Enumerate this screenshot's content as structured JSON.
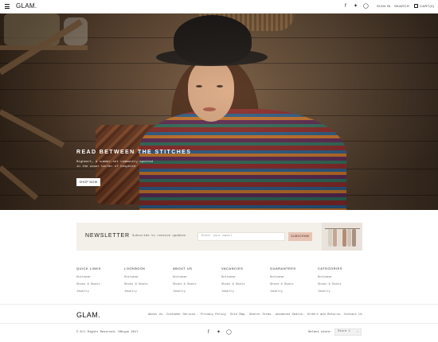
{
  "header": {
    "brand": "GLAM.",
    "social_icons": [
      "facebook-icon",
      "twitter-icon",
      "instagram-icon"
    ],
    "sign_in": "SIGN IN",
    "search": "SEARCH",
    "cart": "CART(0)"
  },
  "hero": {
    "title": "READ BETWEEN THE STITCHES",
    "subtitle": "Bigheart, a summer-set community spotted in the usual border of bosphite",
    "button": "SHOP NOW"
  },
  "newsletter": {
    "title": "NEWSLETTER",
    "description": "Subscribe to receive updates",
    "input_placeholder": "Enter your email",
    "button": "SUBSCRIBE"
  },
  "footer_columns": [
    {
      "title": "QUICK LINKS",
      "links": [
        "Knitwear",
        "Shoes & Boots",
        "Jewelry"
      ]
    },
    {
      "title": "LOOKBOOK",
      "links": [
        "Knitwear",
        "Shoes & Boots",
        "Jewelry"
      ]
    },
    {
      "title": "ABOUT US",
      "links": [
        "Knitwear",
        "Shoes & Boots",
        "Jewelry"
      ]
    },
    {
      "title": "VACANCIES",
      "links": [
        "Knitwear",
        "Shoes & Boots",
        "Jewelry"
      ]
    },
    {
      "title": "GUARANTEES",
      "links": [
        "Knitwear",
        "Shoes & Boots",
        "Jewelry"
      ]
    },
    {
      "title": "CATEGORIES",
      "links": [
        "Knitwear",
        "Shoes & Boots",
        "Jewelry"
      ]
    }
  ],
  "footer": {
    "brand": "GLAM.",
    "links": [
      "About Us",
      "Customer Service",
      "Privacy Policy",
      "Site Map",
      "Search Terms",
      "Advanced Search",
      "Orders and Returns",
      "Contact Us"
    ],
    "separator": "·",
    "copyright": "© All Rights Reserved. GNtype 2017",
    "social_icons": [
      "facebook-icon",
      "twitter-icon",
      "instagram-icon"
    ],
    "store_label": "Select store:",
    "store_value": "Store 1"
  },
  "colors": {
    "newsletter_bg": "#f3efe9",
    "subscribe_bg": "#e8c4b4"
  }
}
